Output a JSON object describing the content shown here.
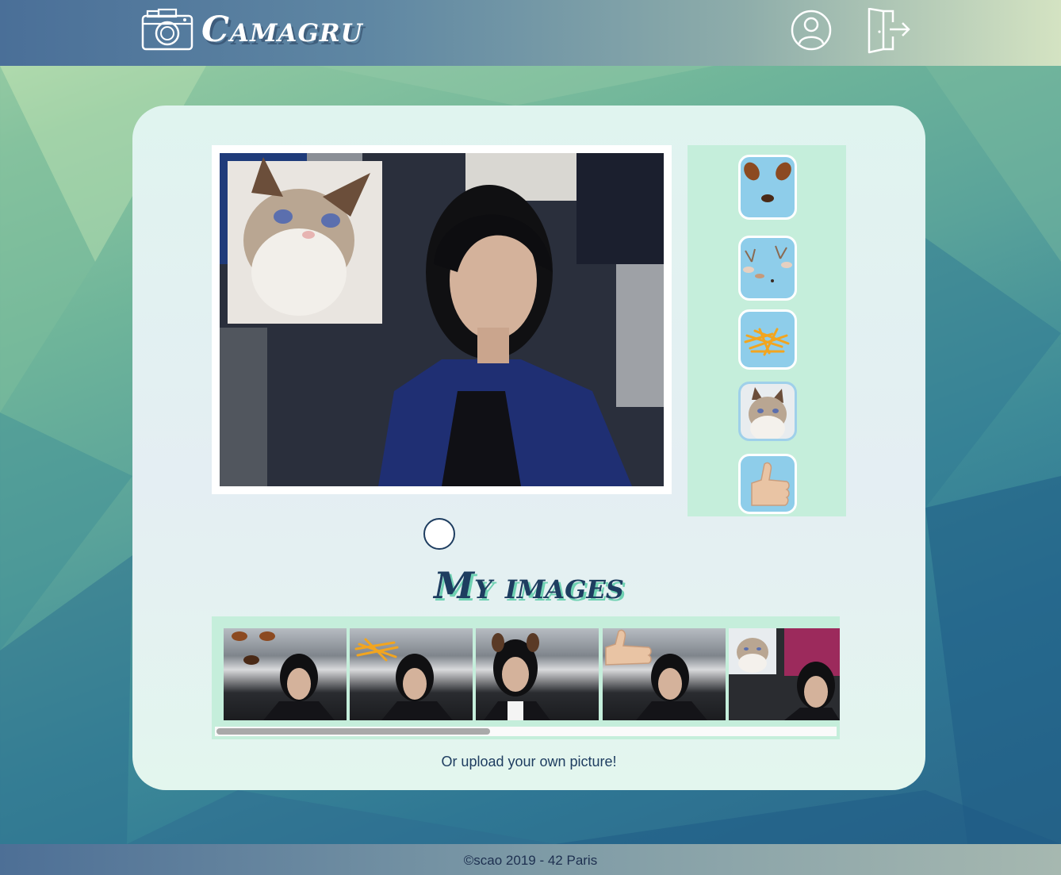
{
  "header": {
    "app_title": "Camagru",
    "logo_icon": "camera-icon",
    "profile_icon": "user-profile-icon",
    "logout_icon": "logout-door-icon"
  },
  "editor": {
    "stickers": [
      {
        "name": "dog-ears-nose-sticker"
      },
      {
        "name": "deer-antlers-sticker"
      },
      {
        "name": "french-fries-sticker"
      },
      {
        "name": "grumpy-cat-sticker",
        "selected": true
      },
      {
        "name": "thumbs-up-sticker"
      }
    ]
  },
  "gallery": {
    "title": "My images"
  },
  "upload": {
    "label": "Or upload your own picture!"
  },
  "footer": {
    "text": "©scao 2019 - 42 Paris"
  },
  "colors": {
    "accent": "#1e3d60",
    "title_shadow": "#6fd1b2",
    "panel": "#c5eedb"
  }
}
